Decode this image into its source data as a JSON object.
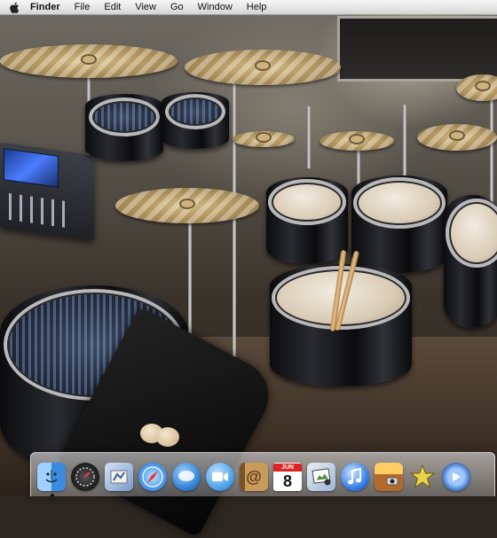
{
  "menubar": {
    "apple_icon": "apple-icon",
    "app_name": "Finder",
    "menus": [
      "File",
      "Edit",
      "View",
      "Go",
      "Window",
      "Help"
    ]
  },
  "dock": {
    "items": [
      {
        "name": "finder",
        "icon": "finder-icon",
        "running": true,
        "color": "#3b8be0"
      },
      {
        "name": "dashboard",
        "icon": "dashboard-icon",
        "running": false,
        "color": "#2a2a2a"
      },
      {
        "name": "mail",
        "icon": "mail-icon",
        "running": false,
        "color": "#6b86b8"
      },
      {
        "name": "safari",
        "icon": "safari-icon",
        "running": false,
        "color": "#3a8ee6"
      },
      {
        "name": "ichat",
        "icon": "ichat-icon",
        "running": false,
        "color": "#2f7fd6"
      },
      {
        "name": "facetime",
        "icon": "facetime-icon",
        "running": false,
        "color": "#4aa0e8"
      },
      {
        "name": "address-book",
        "icon": "address-book-icon",
        "running": false,
        "color": "#b88a4a"
      },
      {
        "name": "ical",
        "icon": "calendar-icon",
        "running": false,
        "color": "#ffffff",
        "month": "JUN",
        "day": "8"
      },
      {
        "name": "iphoto",
        "icon": "iphoto-icon",
        "running": false,
        "color": "#6a93c4"
      },
      {
        "name": "itunes",
        "icon": "itunes-icon",
        "running": false,
        "color": "#2f7be6"
      },
      {
        "name": "photo-booth",
        "icon": "photo-booth-icon",
        "running": false,
        "color": "#8a5a3a"
      },
      {
        "name": "imovie",
        "icon": "imovie-icon",
        "running": false,
        "color": "#c7b23a"
      },
      {
        "name": "dvd-player",
        "icon": "dvd-icon",
        "running": false,
        "color": "#3a6fc4"
      }
    ]
  }
}
